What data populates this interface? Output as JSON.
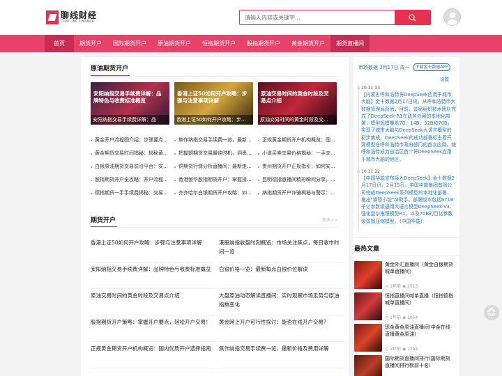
{
  "header": {
    "logo_cn": "聊线财经",
    "logo_en": "CHATLINE FINANCE",
    "search_placeholder": "请输入内容或关键字...",
    "accent": "#e8304f"
  },
  "nav": {
    "items": [
      "首页",
      "期货开户",
      "国际期货开户",
      "原油期货开户",
      "恒指期货开户",
      "股指期货开户",
      "黄金期货开户",
      "期货直播间"
    ],
    "color": "#e8416a"
  },
  "crude": {
    "title": "原油期货开户",
    "cards": [
      {
        "title": "安阳纳指交易手续费详解：品牌特色与收费标准概览",
        "caption": "安阳纳指交易手续费详解：品"
      },
      {
        "title": "香港上证50如何开户攻略：步骤与注意事项详解",
        "caption": "香港上证50如何开户攻略：步..."
      },
      {
        "title": "原油交易时间的黄金时段及交易点介绍",
        "caption": "原油交易时间的黄金时段及交..."
      }
    ],
    "links": [
      "黄金开户流程图介绍：步骤要点...",
      "焦作纳指交易手续费一览，最新...",
      "正规黄金期货开户机构概览：国...",
      "黄金期货交易时间揭秘：揭秘黄...",
      "把握铜期货交易最佳时机，洞悉...",
      "小道买卖交易价格揭秘：一手交...",
      "白银原油期货交易前沿平台：安...",
      "铜期货行情分析直播间：最新走...",
      "贵州期货开户正规指引：如何安...",
      "股指期货开户全攻略：开户流程...",
      "香港恒华股指期货开户：掌握投...",
      "昆明德指直播间精彩瞬间分享，...",
      "德指期货一手手续费揭秘：交易...",
      "齐齐哈尔白银期货开户攻略：如...",
      "纳指期货开户诈骗揭秘与警示：..."
    ]
  },
  "futures": {
    "title": "期货开户",
    "more": "更多>>",
    "items": [
      "香港上证50如何开户攻略：步骤与注意事项详解",
      "港股纳指收盘时刻概览：市场关注焦点，每日收市时间一览",
      "安阳纳指交易手续费详解：品牌特色与收费标准概览",
      "白银价格一览：最新每点白银价位解读",
      "原油交易时间的黄金时段及交易点介绍",
      "大盘原油动态解读直播间：实时观察市场走势与原油指数变化",
      "股指期货开户策略：掌握开户要点，轻松开户交易！",
      "黄金网上开户可行性探讨：能否在线开户交易？",
      "正规黄金期货开户机构概览：国内优质开户选择指南",
      "焦作纳指交易手续费一览，最新价格及费用详解"
    ]
  },
  "market": {
    "date_label": "市场数据 2月17日 周一",
    "tag": "下载金十数据APP",
    "settings": "设置",
    "news": [
      {
        "time": "10:11:33",
        "text": "【内蒙古呼和浩特将DeepSeek应用于城市大脑】金十数据2月17日讯，从呼和浩特市大数据管理局获悉，目前，该局组织技术团队完成了DeepSeek-R1在政务外网的本地化部署，模型规模覆盖7B、14B、32B和70B，实现了城市大脑与DeepSeek大语言模型的初步集成。DeepSeek的成功部署标志着开源模型在呼和浩特市政府部门的首次应用，使呼和浩特成为自治区首个将DeepSeek应用于城市大脑的地区。"
      },
      {
        "time": "10:11:22",
        "text": "【中国华能宣布接入DeepSeek】金十数据2月17日讯，2月15日，中国华能集团有限公司完成DeepSeek系列模型的本地化部署，推出\"睿智小能\"AI助手。部署版本包括671B千亿参数级通用大语言模型DeepSeek-V3、强化复杂推理模型R1，以及70B的百亿参数级蒸馏压缩模型。（中国华能）"
      }
    ]
  },
  "hot": {
    "title": "最热文章",
    "items": [
      {
        "title": "黄金外汇直播间（黄金白银期货喊单直播间）",
        "ago": "1年前",
        "views": "2513"
      },
      {
        "title": "恒指直播间喊单直播（恒指德指喊单直播间）",
        "ago": "1年前",
        "views": "1954"
      },
      {
        "title": "现金黄金原油直播间(中金在线直播黄金原油)",
        "ago": "1年前",
        "views": "1793"
      },
      {
        "title": "国际期货直播间排行(国际期货直播间排行榜前十名)",
        "ago": "1年前",
        "views": "1785"
      }
    ]
  },
  "back_to_top": "TOP"
}
